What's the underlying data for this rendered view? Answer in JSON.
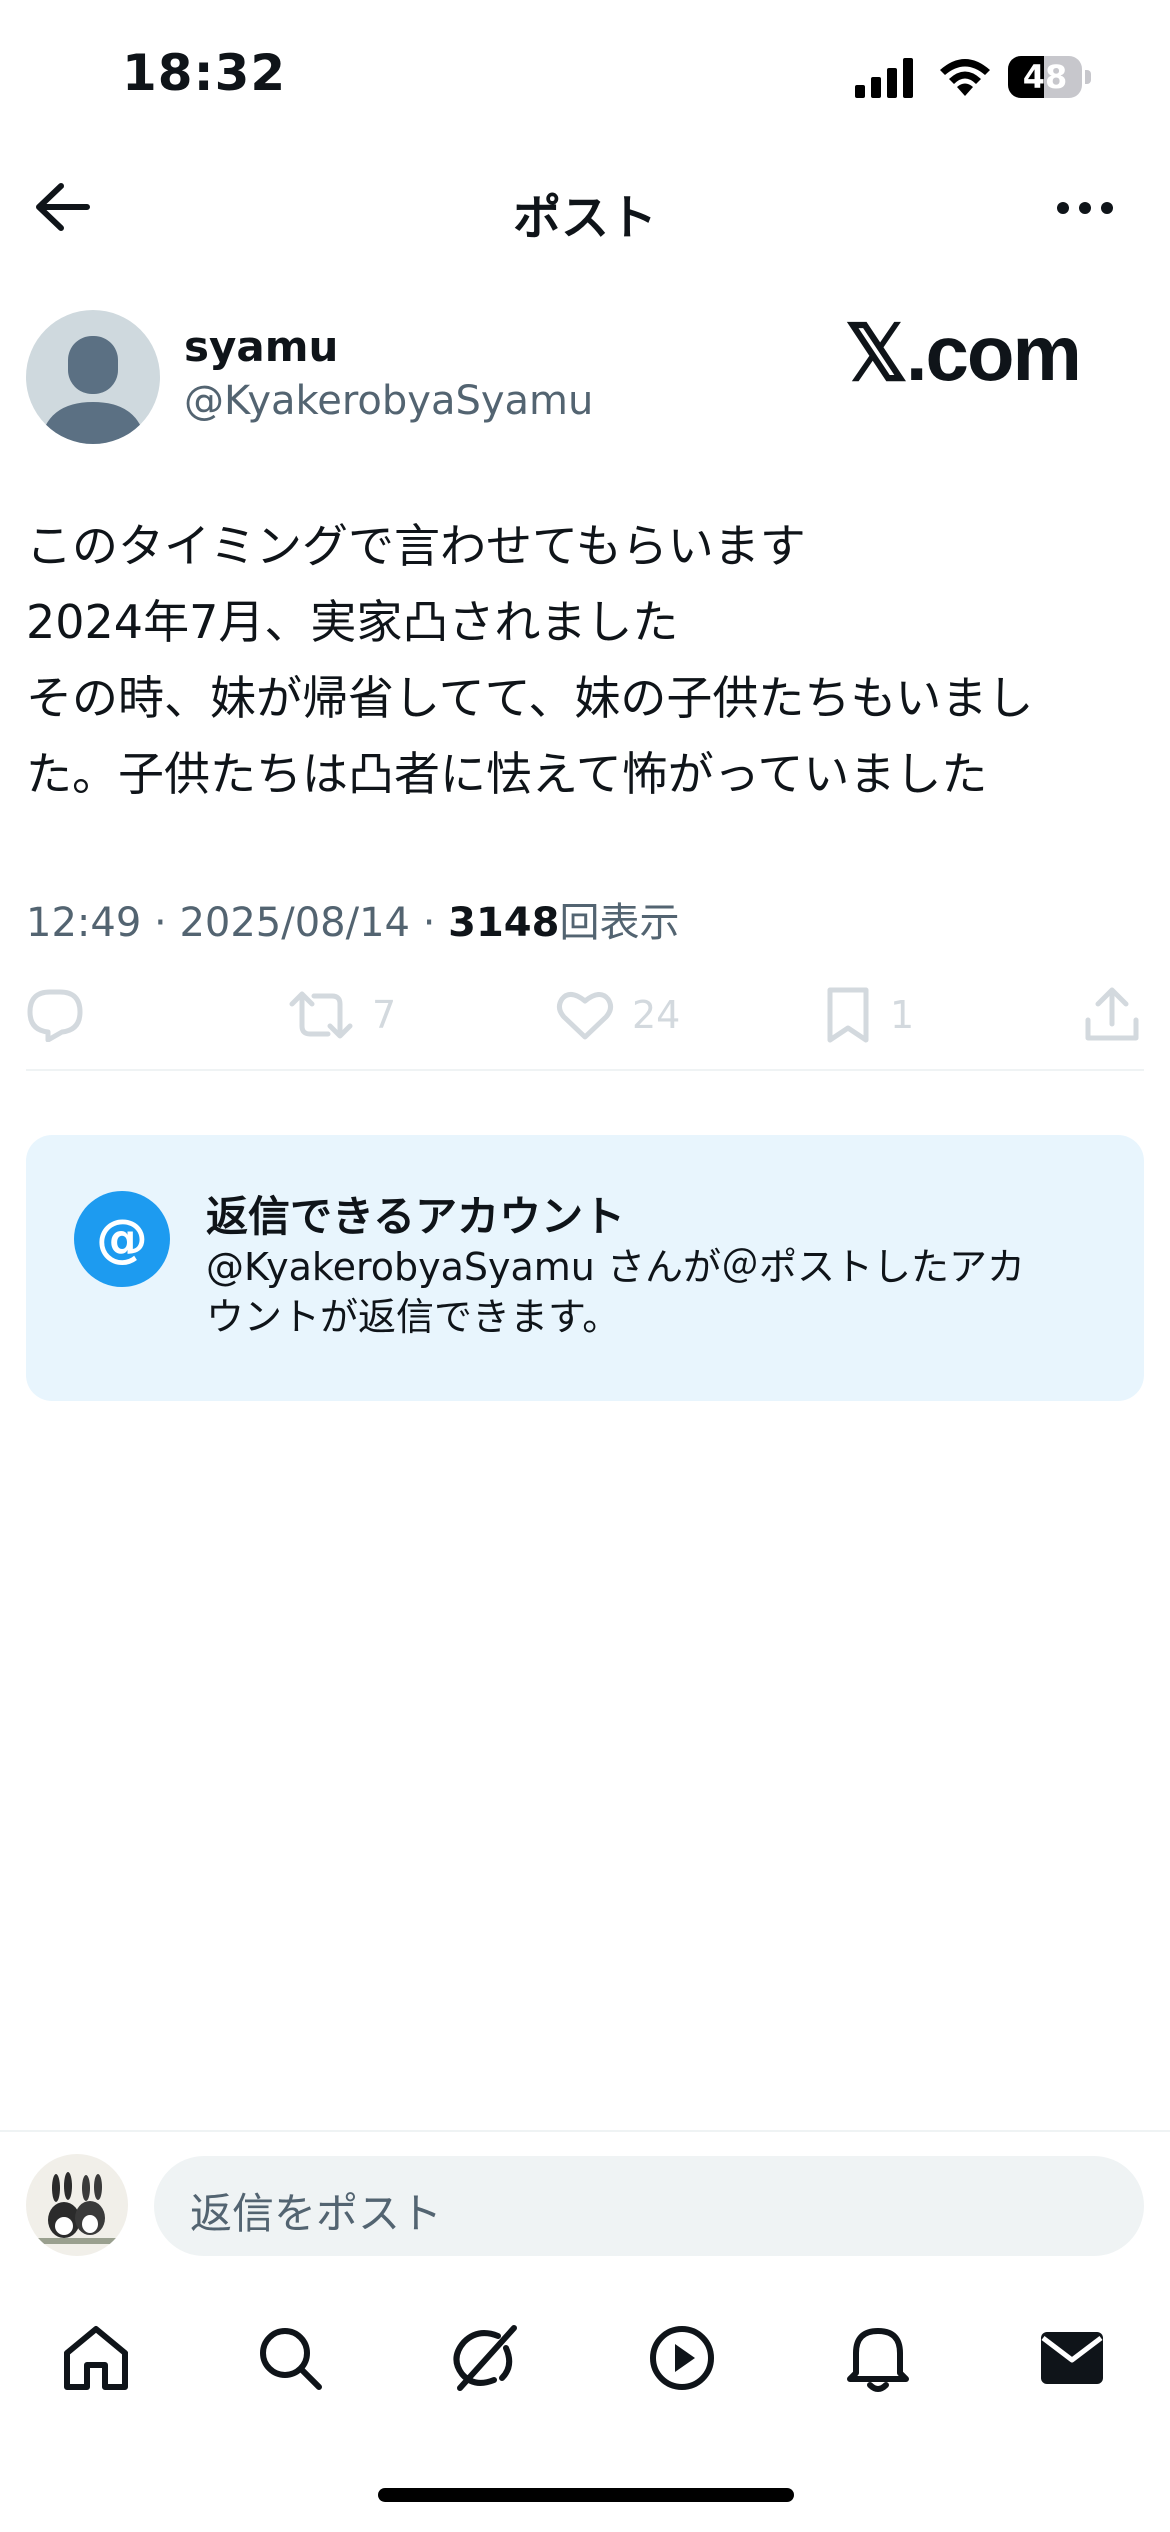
{
  "status_bar": {
    "time": "18:32",
    "battery_level": "48",
    "battery_fraction": 0.48,
    "icons": [
      "signal-icon",
      "wifi-icon",
      "battery-icon"
    ]
  },
  "nav": {
    "title": "ポスト",
    "back_icon": "arrow-left-icon",
    "more_icon": "more-horizontal-icon"
  },
  "post": {
    "author_name": "syamu",
    "author_handle": "@KyakerobyaSyamu",
    "watermark": "𝕏.com",
    "body_lines": [
      "このタイミングで言わせてもらいます",
      "2024年7月、実家凸されました",
      "その時、妹が帰省してて、妹の子供たちもいまし",
      "た。子供たちは凸者に怯えて怖がっていました"
    ],
    "time": "12:49",
    "separator": " · ",
    "date": "2025/08/14",
    "views_count": "3148",
    "views_label": "回表示"
  },
  "actions": {
    "reply_count": "",
    "repost_count": "7",
    "like_count": "24",
    "bookmark_count": "1",
    "icons": [
      "reply-icon",
      "repost-icon",
      "like-icon",
      "bookmark-icon",
      "share-icon"
    ]
  },
  "reply_settings": {
    "icon": "@",
    "title": "返信できるアカウント",
    "description_lines": [
      "@KyakerobyaSyamu さんが＠ポストしたアカ",
      "ウントが返信できます。"
    ]
  },
  "compose": {
    "placeholder": "返信をポスト"
  },
  "tabbar": {
    "items": [
      "home-icon",
      "search-icon",
      "grok-icon",
      "video-icon",
      "notifications-icon",
      "messages-icon"
    ]
  },
  "colors": {
    "text": "#0f1419",
    "secondary": "#536471",
    "accent": "#1d9bf0",
    "reply_card_bg": "#e8f5fd"
  }
}
